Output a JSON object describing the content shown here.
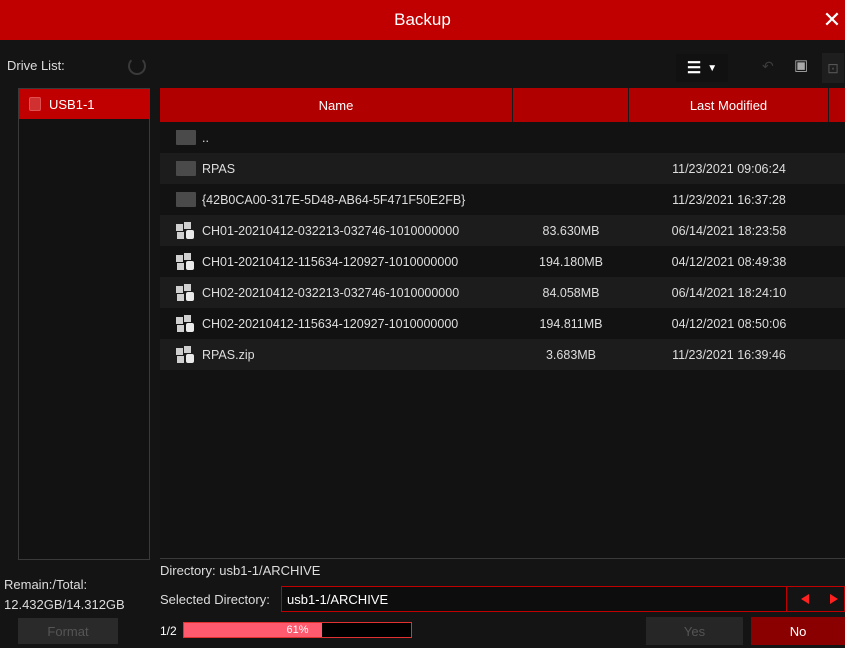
{
  "window": {
    "title": "Backup",
    "close_glyph": "✕"
  },
  "drive_panel": {
    "label": "Drive List:",
    "drives": [
      {
        "label": "USB1-1",
        "selected": true
      }
    ],
    "remain_label": "Remain:/Total:",
    "remain_value": "12.432GB/14.312GB",
    "format_label": "Format"
  },
  "toolbar": {
    "view_icon": "list-view-icon",
    "icons": [
      "back-icon",
      "new-folder-icon",
      "lock-icon"
    ]
  },
  "table": {
    "columns": {
      "name": "Name",
      "size": "",
      "modified": "Last Modified"
    },
    "rows": [
      {
        "type": "folder",
        "name": "..",
        "size": "",
        "modified": ""
      },
      {
        "type": "folder",
        "name": "RPAS",
        "size": "",
        "modified": "11/23/2021 09:06:24"
      },
      {
        "type": "folder",
        "name": "{42B0CA00-317E-5D48-AB64-5F471F50E2FB}",
        "size": "",
        "modified": "11/23/2021 16:37:28"
      },
      {
        "type": "file",
        "name": "CH01-20210412-032213-032746-1010000000",
        "size": "83.630MB",
        "modified": "06/14/2021 18:23:58"
      },
      {
        "type": "file",
        "name": "CH01-20210412-115634-120927-1010000000",
        "size": "194.180MB",
        "modified": "04/12/2021 08:49:38"
      },
      {
        "type": "file",
        "name": "CH02-20210412-032213-032746-1010000000",
        "size": "84.058MB",
        "modified": "06/14/2021 18:24:10"
      },
      {
        "type": "file",
        "name": "CH02-20210412-115634-120927-1010000000",
        "size": "194.811MB",
        "modified": "04/12/2021 08:50:06"
      },
      {
        "type": "file",
        "name": "RPAS.zip",
        "size": "3.683MB",
        "modified": "11/23/2021 16:39:46"
      }
    ]
  },
  "directory": {
    "label": "Directory:",
    "path": "usb1-1/ARCHIVE",
    "selected_label": "Selected Directory:",
    "selected_value": "usb1-1/ARCHIVE"
  },
  "progress": {
    "page": "1/2",
    "percent_text": "61%",
    "percent": 61
  },
  "buttons": {
    "yes": "Yes",
    "no": "No"
  },
  "colors": {
    "accent": "#c00000",
    "progress_fill": "#ff5a6e"
  }
}
